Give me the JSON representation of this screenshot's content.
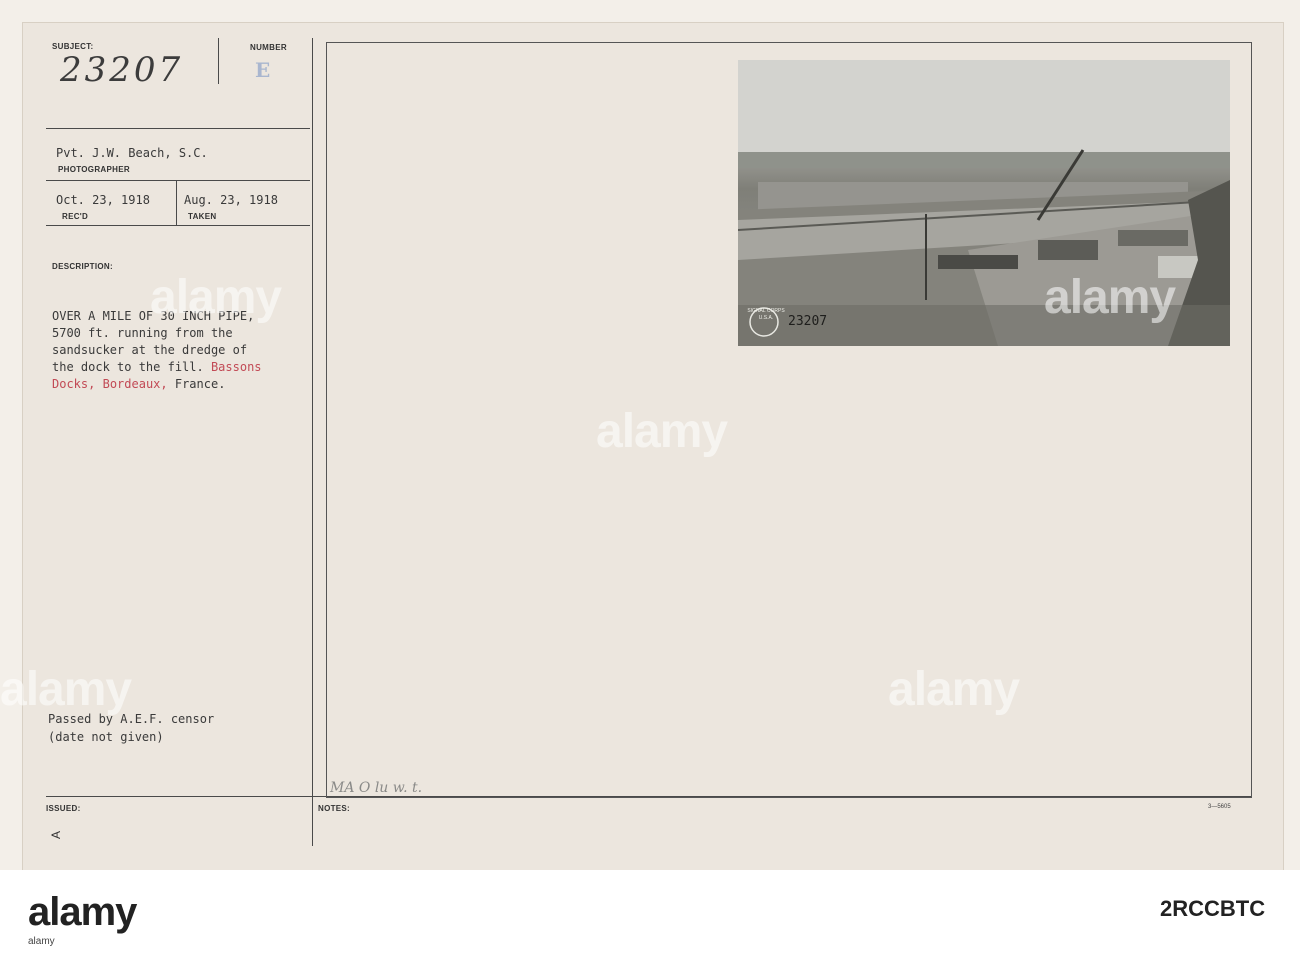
{
  "card": {
    "subject_label": "SUBJECT:",
    "subject_value": "23207",
    "number_label": "NUMBER",
    "number_value": "E",
    "photographer_name": "Pvt. J.W. Beach, S.C.",
    "photographer_label": "PHOTOGRAPHER",
    "received_date": "Oct. 23, 1918",
    "received_label": "REC'D",
    "taken_date": "Aug. 23, 1918",
    "taken_label": "TAKEN",
    "description_label": "DESCRIPTION:",
    "description_lines": [
      "OVER A MILE OF 30 INCH PIPE,",
      "5700 ft. running from the",
      "sandsucker at the dredge of",
      "the dock to the fill."
    ],
    "description_red_1": "Bassons",
    "description_red_2": "Docks,",
    "description_red_3": "Bordeaux,",
    "description_end": "France.",
    "censor_line_1": "Passed by A.E.F. censor",
    "censor_line_2": "(date not given)",
    "issued_label": "ISSUED:",
    "issued_mark": "A",
    "notes_label": "NOTES:",
    "notes_handwriting": "MA O lu w. t.",
    "form_number": "3—5605"
  },
  "photo": {
    "stamp_number": "23207",
    "seal_text": "SIGNAL CORPS U.S.A."
  },
  "watermark": {
    "text": "alamy"
  },
  "footer": {
    "brand": "alamy",
    "image_id": "2RCCBTC"
  }
}
